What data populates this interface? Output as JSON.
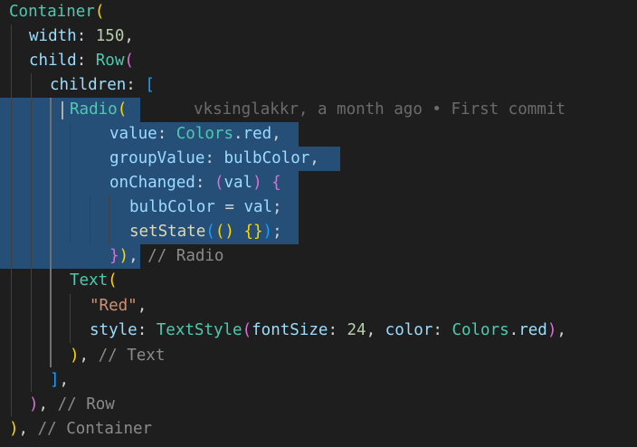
{
  "editor": {
    "blame": "vksinglakkr, a month ago • First commit",
    "tokens": {
      "container": "Container",
      "width_prop": "width",
      "width_val": "150",
      "child_prop": "child",
      "row": "Row",
      "children_prop": "children",
      "radio": "Radio",
      "value_prop": "value",
      "colors": "Colors",
      "red": "red",
      "groupvalue_prop": "groupValue",
      "bulbcolor": "bulbColor",
      "onchanged_prop": "onChanged",
      "val": "val",
      "setstate": "setState",
      "text": "Text",
      "red_string": "\"Red\"",
      "style_prop": "style",
      "textstyle": "TextStyle",
      "fontsize_prop": "fontSize",
      "fontsize_val": "24",
      "color_prop": "color",
      "cmt_radio": "// Radio",
      "cmt_text": "// Text",
      "cmt_row": "// Row",
      "cmt_container": "// Container"
    }
  }
}
